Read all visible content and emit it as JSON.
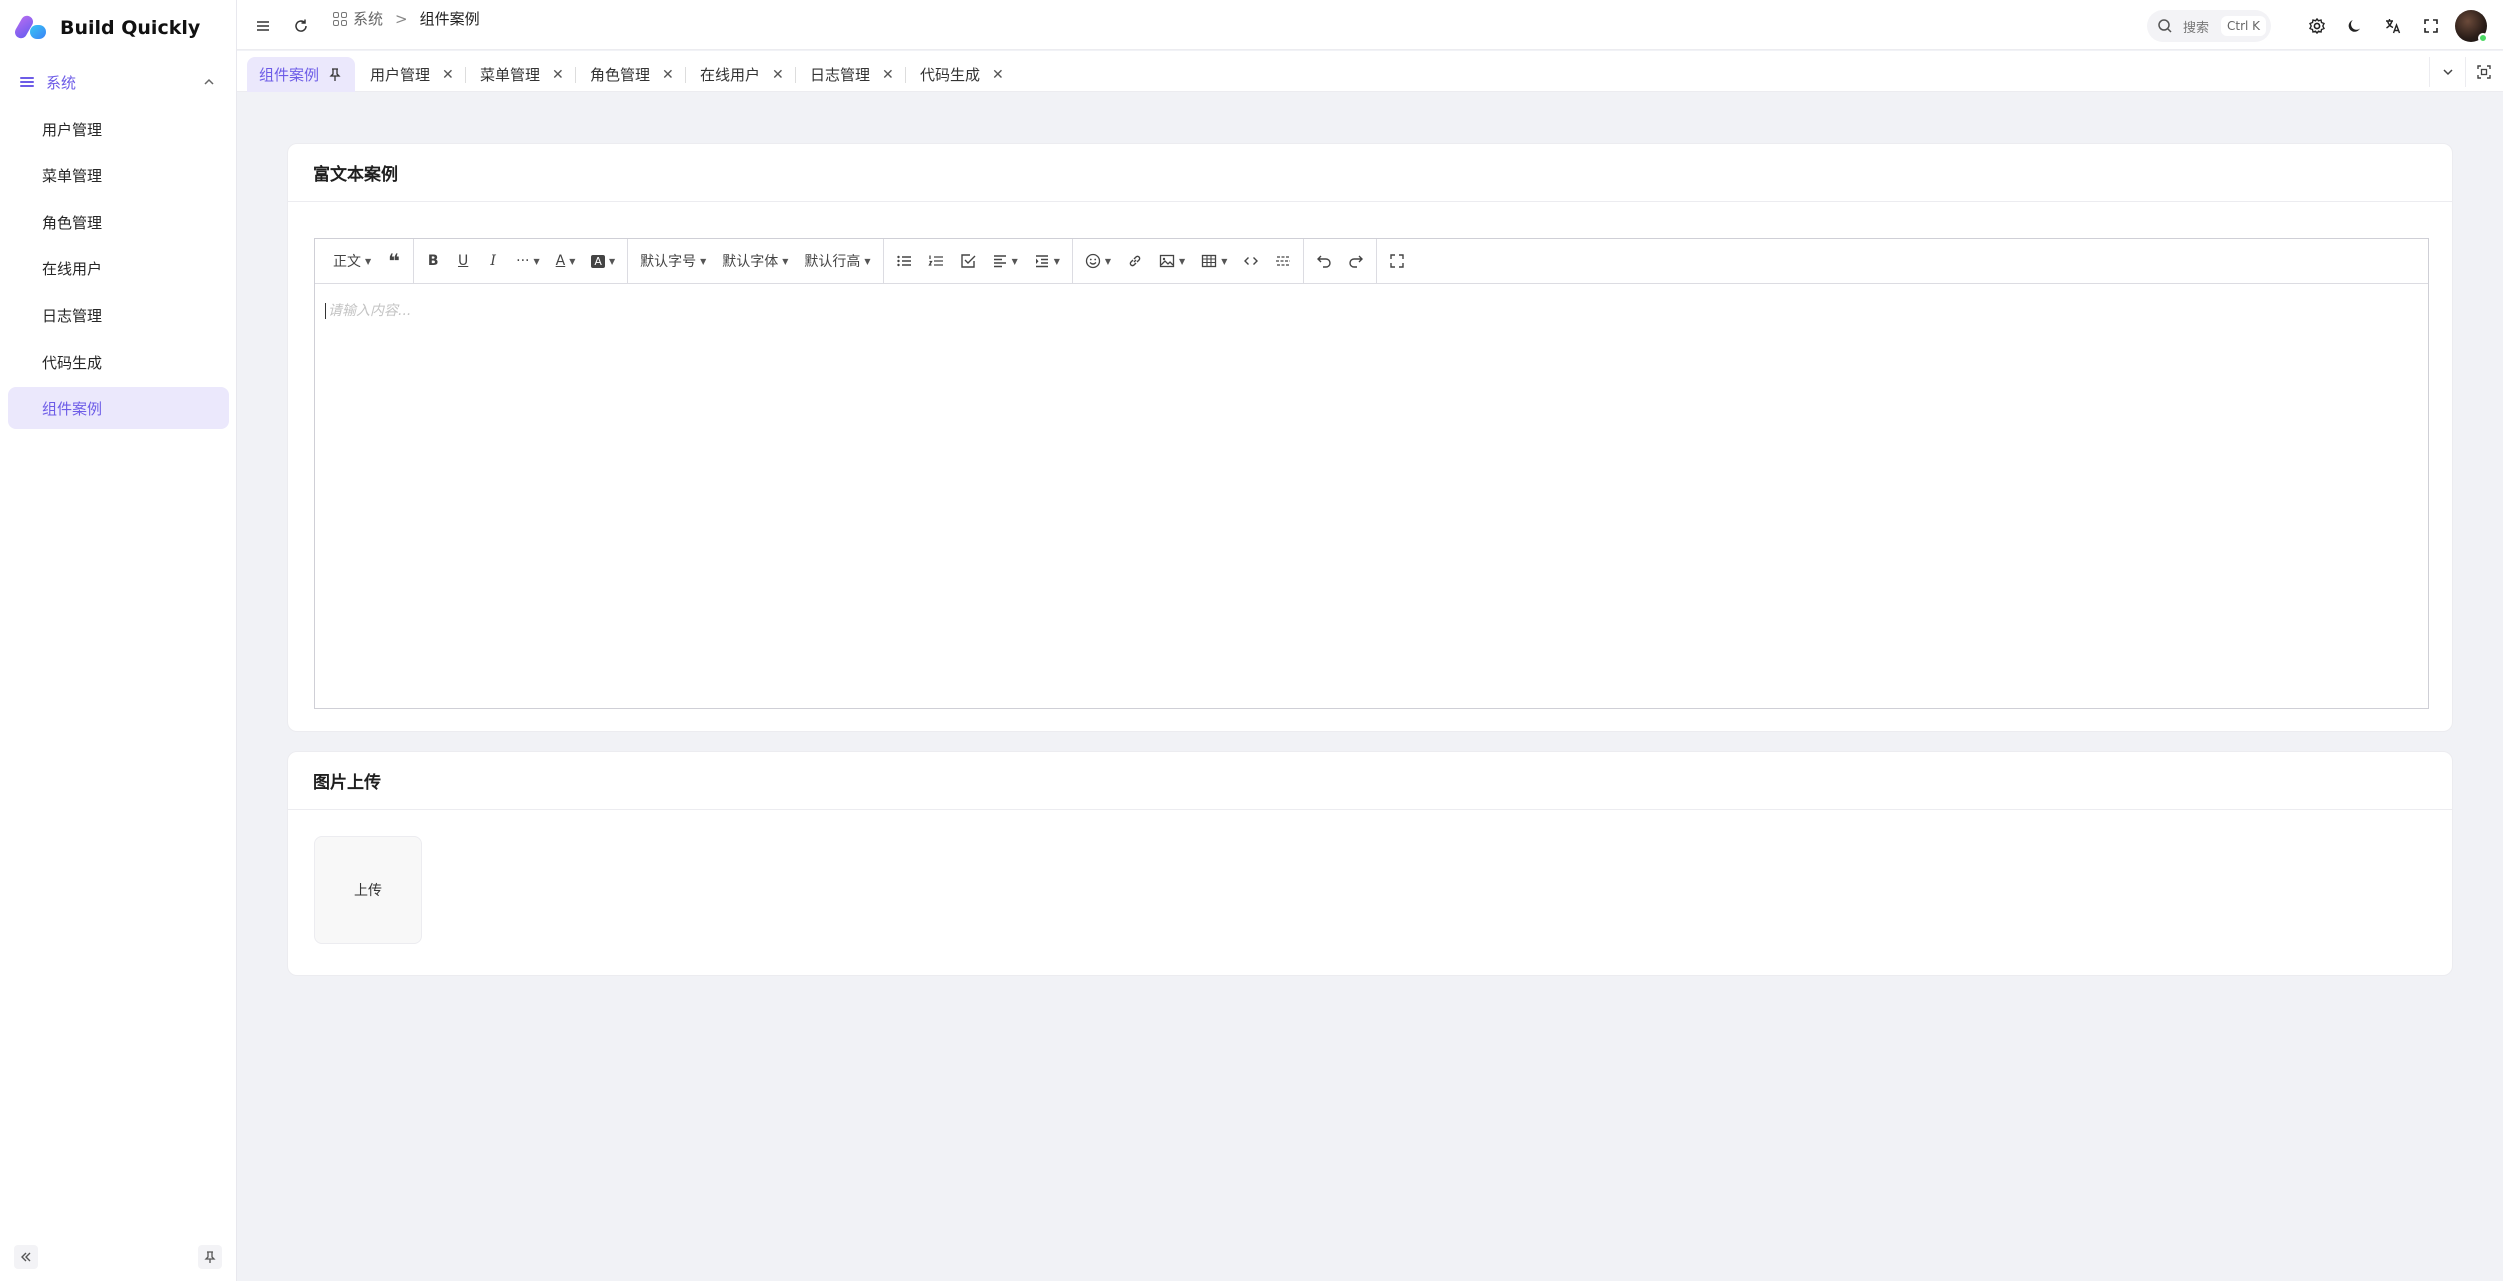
{
  "app": {
    "brand": "Build Quickly"
  },
  "sidebar": {
    "group": {
      "label": "系统",
      "expanded": true
    },
    "items": [
      {
        "label": "用户管理"
      },
      {
        "label": "菜单管理"
      },
      {
        "label": "角色管理"
      },
      {
        "label": "在线用户"
      },
      {
        "label": "日志管理"
      },
      {
        "label": "代码生成"
      },
      {
        "label": "组件案例",
        "active": true
      }
    ]
  },
  "header": {
    "breadcrumb": {
      "parent": "系统",
      "current": "组件案例"
    },
    "search": {
      "placeholder": "搜索",
      "shortcut": "Ctrl K"
    }
  },
  "tabs": [
    {
      "label": "组件案例",
      "active": true,
      "pinned": true
    },
    {
      "label": "用户管理"
    },
    {
      "label": "菜单管理"
    },
    {
      "label": "角色管理"
    },
    {
      "label": "在线用户"
    },
    {
      "label": "日志管理"
    },
    {
      "label": "代码生成"
    }
  ],
  "rich_text": {
    "title": "富文本案例",
    "toolbar": {
      "paragraph": "正文",
      "font_size": "默认字号",
      "font_family": "默认字体",
      "line_height": "默认行高"
    },
    "placeholder": "请输入内容..."
  },
  "upload": {
    "title": "图片上传",
    "button": "上传"
  },
  "colors": {
    "accent": "#6d5ce7",
    "accent_bg": "#ebe8fc",
    "page_bg": "#f1f2f6"
  }
}
